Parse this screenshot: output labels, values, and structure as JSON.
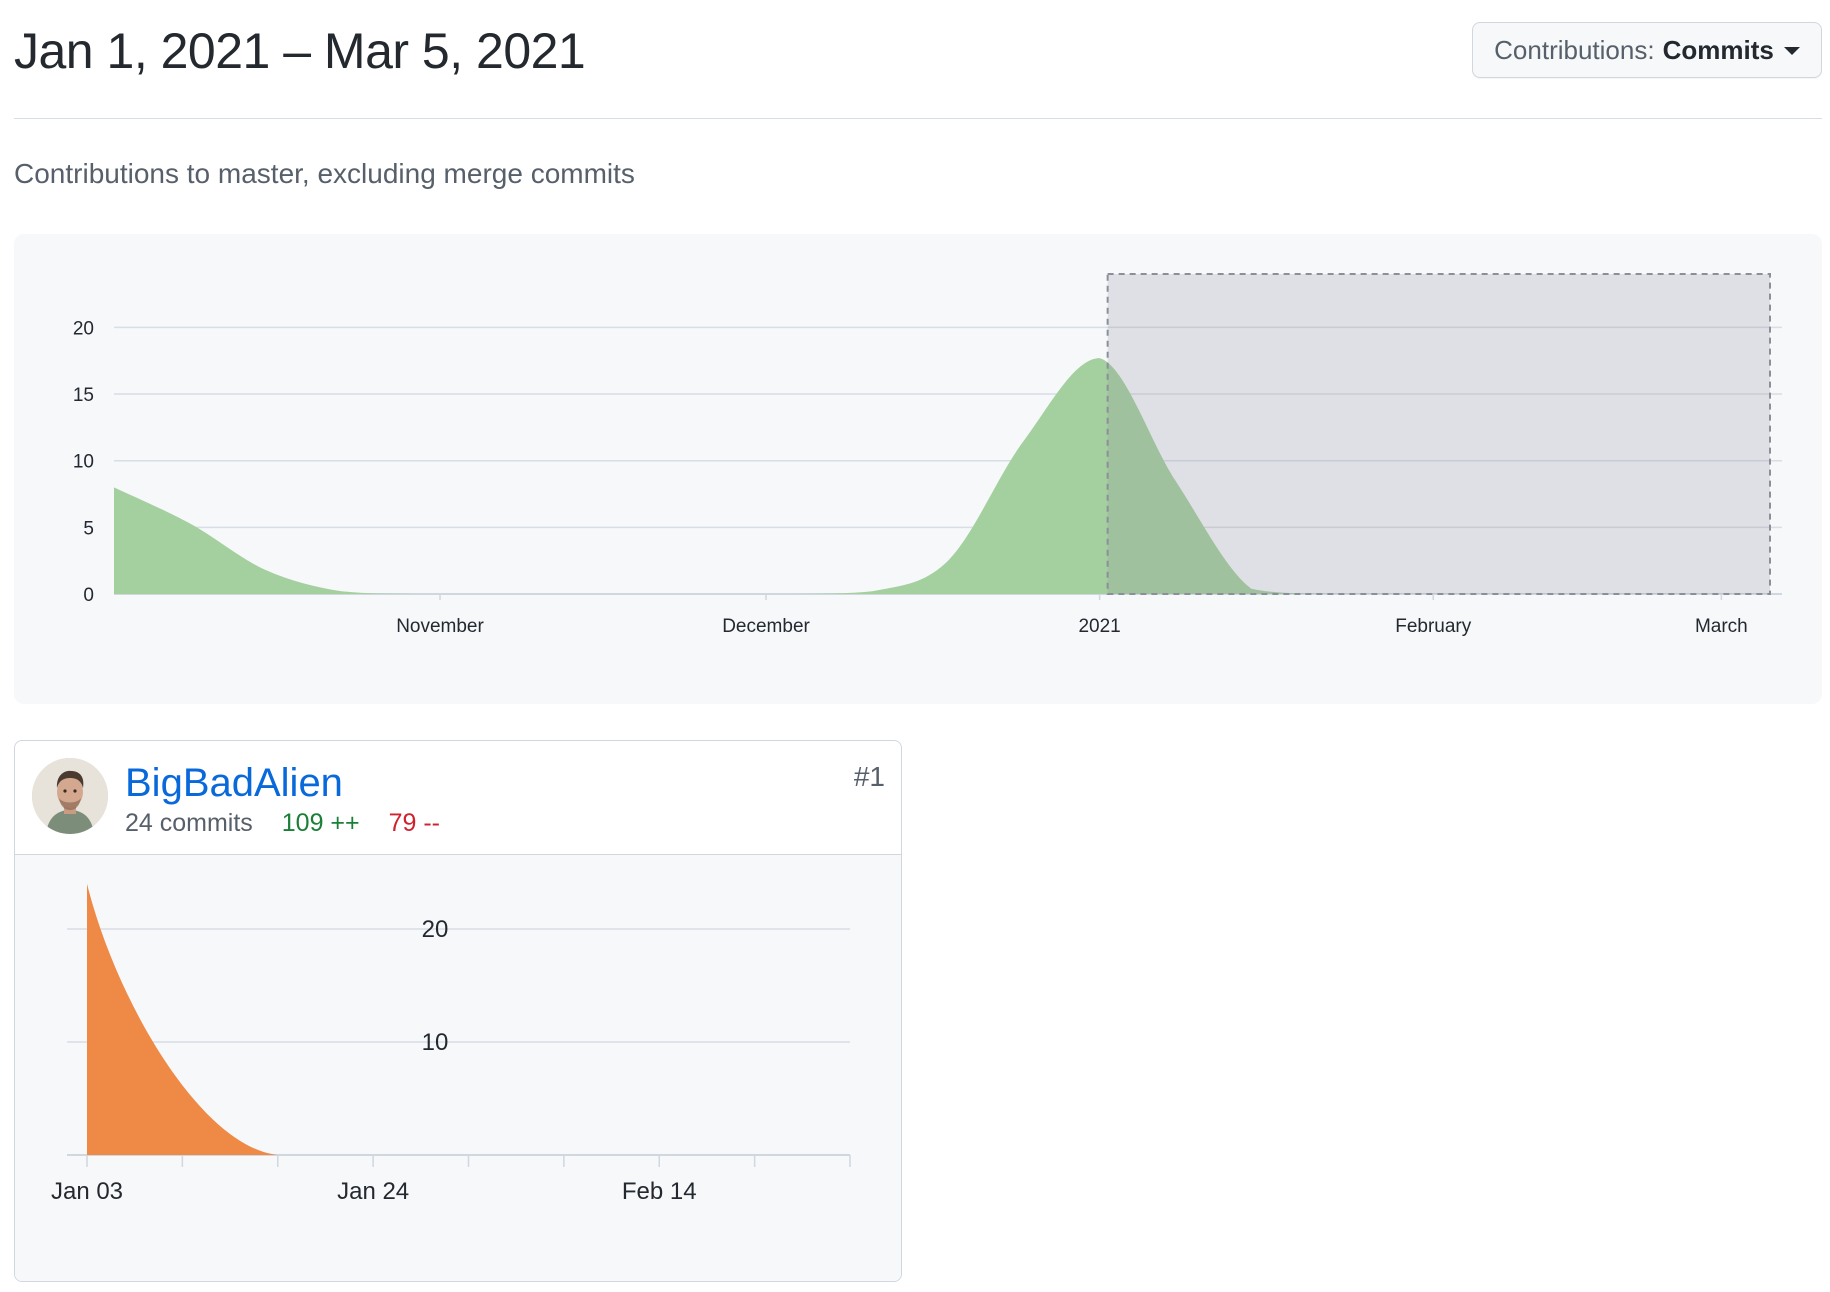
{
  "header": {
    "date_range": "Jan 1, 2021 – Mar 5, 2021",
    "contributions_label": "Contributions:",
    "contributions_value": "Commits"
  },
  "subtitle": "Contributions to master, excluding merge commits",
  "chart_data": [
    {
      "type": "area",
      "color": "#a4d09f",
      "overlay_color": "#8c8f99",
      "yticks": [
        0,
        5,
        10,
        15,
        20
      ],
      "ylim": [
        0,
        24
      ],
      "x_labels": [
        "November",
        "December",
        "2021",
        "February",
        "March"
      ],
      "selection": {
        "from": "Jan 1, 2021",
        "to": "Mar 5, 2021"
      },
      "points": [
        {
          "x": "Oct 3",
          "y": 8.0
        },
        {
          "x": "Oct 10",
          "y": 5.3
        },
        {
          "x": "Oct 17",
          "y": 1.8
        },
        {
          "x": "Oct 24",
          "y": 0.2
        },
        {
          "x": "Oct 31",
          "y": 0
        },
        {
          "x": "Nov 7",
          "y": 0
        },
        {
          "x": "Nov 14",
          "y": 0
        },
        {
          "x": "Nov 21",
          "y": 0
        },
        {
          "x": "Nov 28",
          "y": 0
        },
        {
          "x": "Dec 5",
          "y": 0
        },
        {
          "x": "Dec 12",
          "y": 0.2
        },
        {
          "x": "Dec 19",
          "y": 2.5
        },
        {
          "x": "Dec 26",
          "y": 11.5
        },
        {
          "x": "Jan 1",
          "y": 17.7
        },
        {
          "x": "Jan 8",
          "y": 8.5
        },
        {
          "x": "Jan 15",
          "y": 0.4
        },
        {
          "x": "Jan 22",
          "y": 0
        },
        {
          "x": "Jan 29",
          "y": 0
        },
        {
          "x": "Feb 5",
          "y": 0
        },
        {
          "x": "Feb 12",
          "y": 0
        },
        {
          "x": "Feb 19",
          "y": 0
        },
        {
          "x": "Feb 26",
          "y": 0
        },
        {
          "x": "Mar 5",
          "y": 0
        }
      ]
    },
    {
      "type": "area",
      "color": "#ee8a45",
      "yticks": [
        10,
        20
      ],
      "ylim": [
        0,
        24
      ],
      "x_labels": [
        "Jan 03",
        "Jan 24",
        "Feb 14"
      ],
      "points": [
        {
          "x": "Jan 03",
          "y": 24
        },
        {
          "x": "Jan 10",
          "y": 5
        },
        {
          "x": "Jan 17",
          "y": 0
        },
        {
          "x": "Jan 24",
          "y": 0
        },
        {
          "x": "Jan 31",
          "y": 0
        },
        {
          "x": "Feb 07",
          "y": 0
        },
        {
          "x": "Feb 14",
          "y": 0
        },
        {
          "x": "Feb 21",
          "y": 0
        },
        {
          "x": "Feb 28",
          "y": 0
        }
      ]
    }
  ],
  "contributors": [
    {
      "name": "BigBadAlien",
      "rank": "#1",
      "commits": "24 commits",
      "additions": "109 ++",
      "deletions": "79 --",
      "avatar_icon": "person-avatar"
    }
  ]
}
